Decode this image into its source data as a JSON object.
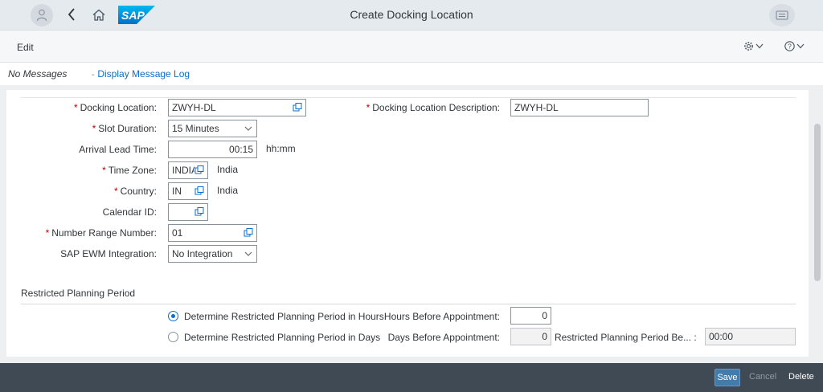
{
  "shell": {
    "title": "Create Docking Location",
    "logo_text": "SAP",
    "icons": {
      "avatar": "user-icon",
      "back": "back-icon",
      "home": "home-icon",
      "menu": "notifications-menu-icon"
    }
  },
  "toolbar": {
    "edit_label": "Edit",
    "settings_icon": "gear-icon",
    "help_icon": "help-icon"
  },
  "messages": {
    "status": "No Messages",
    "log_link": "Display Message Log"
  },
  "form": {
    "docking_location": {
      "label": "Docking Location:",
      "value": "ZWYH-DL",
      "required": true
    },
    "docking_location_desc": {
      "label": "Docking Location Description:",
      "value": "ZWYH-DL",
      "required": true
    },
    "slot_duration": {
      "label": "Slot Duration:",
      "value": "15 Minutes",
      "required": true
    },
    "arrival_lead_time": {
      "label": "Arrival Lead Time:",
      "value": "00:15",
      "unit": "hh:mm"
    },
    "time_zone": {
      "label": "Time Zone:",
      "value": "INDIA",
      "desc": "India",
      "required": true
    },
    "country": {
      "label": "Country:",
      "value": "IN",
      "desc": "India",
      "required": true
    },
    "calendar_id": {
      "label": "Calendar ID:",
      "value": ""
    },
    "number_range": {
      "label": "Number Range Number:",
      "value": "01",
      "required": true
    },
    "ewm_integration": {
      "label": "SAP EWM Integration:",
      "value": "No Integration"
    }
  },
  "restricted": {
    "section_title": "Restricted Planning Period",
    "opt_hours": {
      "label": "Determine Restricted Planning Period in Hours",
      "selected": true
    },
    "opt_days": {
      "label": "Determine Restricted Planning Period in Days",
      "selected": false
    },
    "hours_before": {
      "label": "Hours Before Appointment:",
      "value": "0"
    },
    "days_before": {
      "label": "Days Before Appointment:",
      "value": "0"
    },
    "period_before": {
      "label": "Restricted Planning Period Be... :",
      "value": "00:00"
    }
  },
  "footer": {
    "save": "Save",
    "cancel": "Cancel",
    "delete": "Delete"
  },
  "colors": {
    "accent": "#0a6ed1",
    "required": "#bb0000",
    "footer_bg": "#3f4a55",
    "save_bg": "#427cac"
  }
}
